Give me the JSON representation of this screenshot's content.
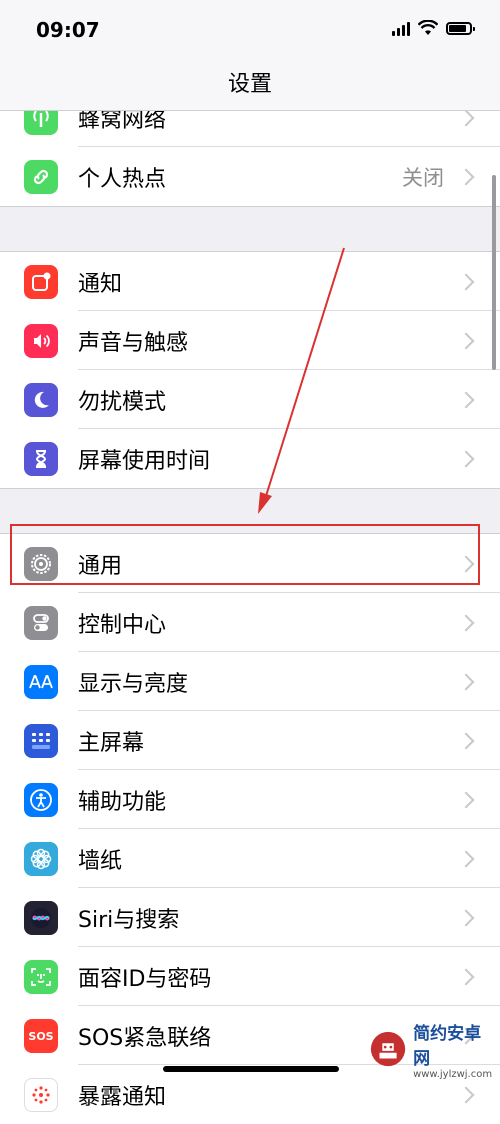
{
  "status_bar": {
    "time": "09:07"
  },
  "nav": {
    "title": "设置"
  },
  "groups": [
    [
      {
        "label": "蜂窝网络",
        "icon": "cellular-icon",
        "color": "#4cd964"
      },
      {
        "label": "个人热点",
        "value": "关闭",
        "icon": "hotspot-icon",
        "color": "#4cd964"
      }
    ],
    [
      {
        "label": "通知",
        "icon": "notification-icon",
        "color": "#ff3b30"
      },
      {
        "label": "声音与触感",
        "icon": "speaker-icon",
        "color": "#ff2d55"
      },
      {
        "label": "勿扰模式",
        "icon": "moon-icon",
        "color": "#5856d6"
      },
      {
        "label": "屏幕使用时间",
        "icon": "hourglass-icon",
        "color": "#5856d6"
      }
    ],
    [
      {
        "label": "通用",
        "icon": "gear-icon",
        "color": "#8e8e93"
      },
      {
        "label": "控制中心",
        "icon": "toggle-icon",
        "color": "#8e8e93"
      },
      {
        "label": "显示与亮度",
        "icon": "text-size-icon",
        "color": "#007aff"
      },
      {
        "label": "主屏幕",
        "icon": "home-grid-icon",
        "color": "#2c5ad9"
      },
      {
        "label": "辅助功能",
        "icon": "accessibility-icon",
        "color": "#007aff"
      },
      {
        "label": "墙纸",
        "icon": "flower-icon",
        "color": "#34aadc"
      },
      {
        "label": "Siri与搜索",
        "icon": "siri-icon",
        "color": "#222233"
      },
      {
        "label": "面容ID与密码",
        "icon": "faceid-icon",
        "color": "#4cd964"
      },
      {
        "label": "SOS紧急联络",
        "icon": "sos-icon",
        "color": "#ff3b30"
      },
      {
        "label": "暴露通知",
        "icon": "exposure-icon",
        "color": "#ffffff"
      }
    ]
  ],
  "annotation": {
    "highlight_color": "#d9322f"
  },
  "watermark": {
    "main": "简约安卓网",
    "sub": "www.jylzwj.com"
  }
}
